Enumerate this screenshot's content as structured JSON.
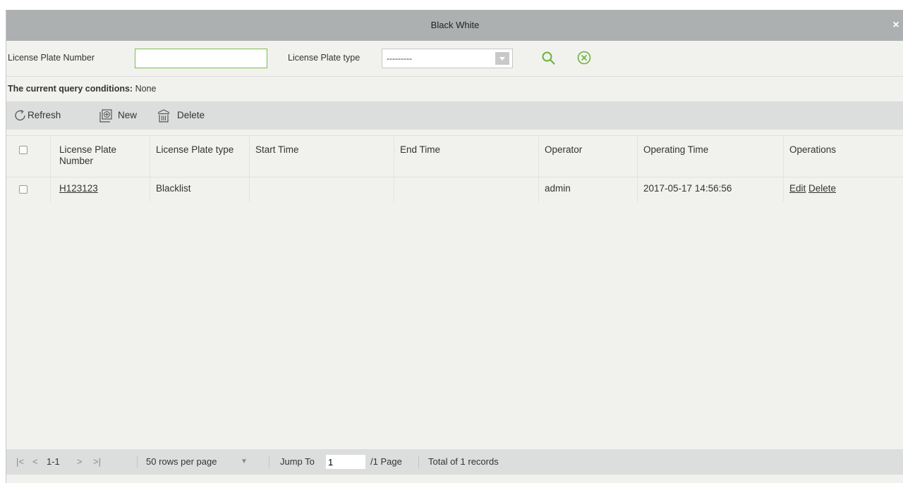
{
  "window": {
    "title": "Black White",
    "close_label": "×"
  },
  "filters": {
    "plate_number_label": "License Plate Number",
    "plate_number_value": "",
    "plate_type_label": "License Plate type",
    "plate_type_value": "---------",
    "search_icon": "search-icon",
    "clear_icon": "clear-circle-icon"
  },
  "query": {
    "label": "The current query conditions:",
    "value": " None"
  },
  "toolbar": {
    "refresh": "Refresh",
    "new": "New",
    "delete": "Delete"
  },
  "table": {
    "headers": {
      "plate_number": "License Plate Number",
      "plate_type": "License Plate type",
      "start_time": "Start Time",
      "end_time": "End Time",
      "operator": "Operator",
      "operating_time": "Operating Time",
      "operations": "Operations"
    },
    "rows": [
      {
        "plate_number": "H123123",
        "plate_type": "Blacklist",
        "start_time": "",
        "end_time": "",
        "operator": "admin",
        "operating_time": "2017-05-17 14:56:56",
        "edit": "Edit",
        "delete": "Delete"
      }
    ]
  },
  "pager": {
    "first": "|<",
    "prev": "<",
    "range": "1-1",
    "next": ">",
    "last": ">|",
    "rows_per_page": "50 rows per page",
    "jump_label": "Jump To",
    "jump_value": "1",
    "pages": "/1 Page",
    "total": "Total of 1 records"
  },
  "colors": {
    "accent": "#6cb33f",
    "titlebar": "#adb0b0",
    "toolbar": "#dcdddd",
    "background": "#f1f2ed"
  }
}
